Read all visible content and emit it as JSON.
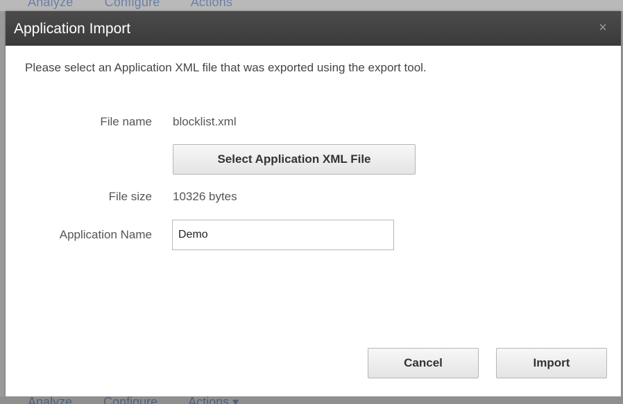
{
  "background": {
    "top_nav": [
      "Analyze",
      "Configure",
      "Actions"
    ],
    "bottom_nav": [
      "Analyze",
      "Configure",
      "Actions ▾"
    ]
  },
  "dialog": {
    "title": "Application Import",
    "close_glyph": "×",
    "instruction": "Please select an Application XML file that was exported using the export tool.",
    "file_name_label": "File name",
    "file_name_value": "blocklist.xml",
    "select_button_label": "Select Application XML File",
    "file_size_label": "File size",
    "file_size_value": "10326 bytes",
    "app_name_label": "Application Name",
    "app_name_value": "Demo",
    "cancel_label": "Cancel",
    "import_label": "Import"
  },
  "colors": {
    "titlebar": "#424242",
    "text": "#555555"
  }
}
